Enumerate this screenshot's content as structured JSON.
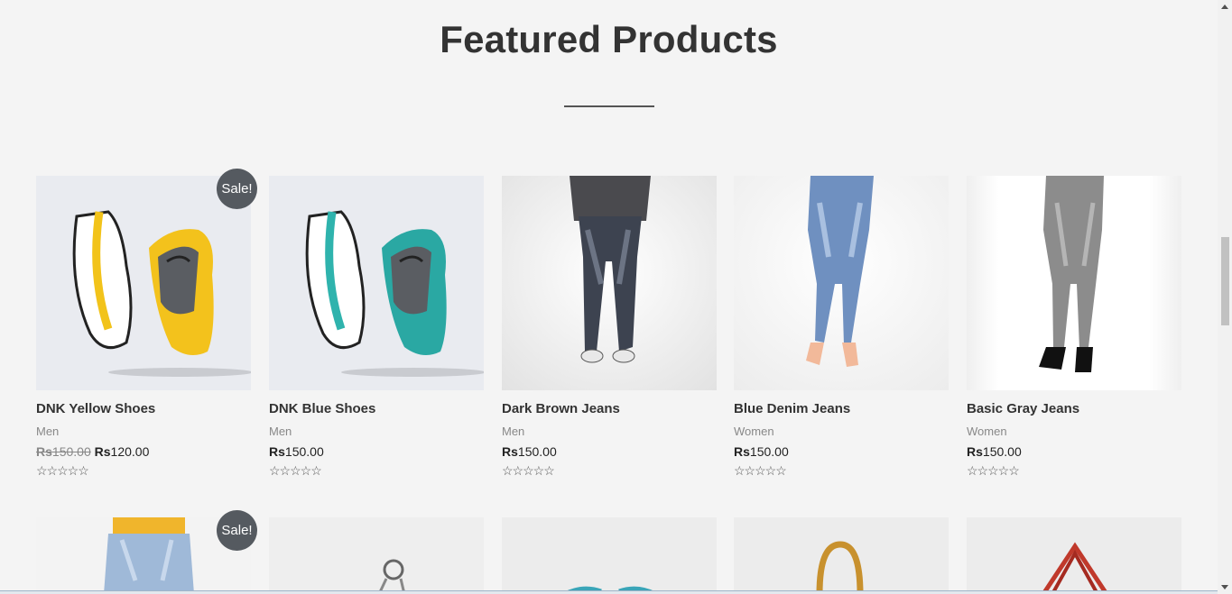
{
  "section": {
    "title": "Featured Products"
  },
  "sale_label": "Sale!",
  "products": [
    {
      "name": "DNK Yellow Shoes",
      "category": "Men",
      "currency": "Rs",
      "old_price": "150.00",
      "price": "120.00",
      "on_sale": true,
      "rating": 0
    },
    {
      "name": "DNK Blue Shoes",
      "category": "Men",
      "currency": "Rs",
      "price": "150.00",
      "on_sale": false,
      "rating": 0
    },
    {
      "name": "Dark Brown Jeans",
      "category": "Men",
      "currency": "Rs",
      "price": "150.00",
      "on_sale": false,
      "rating": 0
    },
    {
      "name": "Blue Denim Jeans",
      "category": "Women",
      "currency": "Rs",
      "price": "150.00",
      "on_sale": false,
      "rating": 0
    },
    {
      "name": "Basic Gray Jeans",
      "category": "Women",
      "currency": "Rs",
      "price": "150.00",
      "on_sale": false,
      "rating": 0
    }
  ],
  "stars_glyph": "☆☆☆☆☆",
  "colors": {
    "background": "#f4f4f4",
    "sale_badge": "#555a60",
    "title": "#333333"
  }
}
